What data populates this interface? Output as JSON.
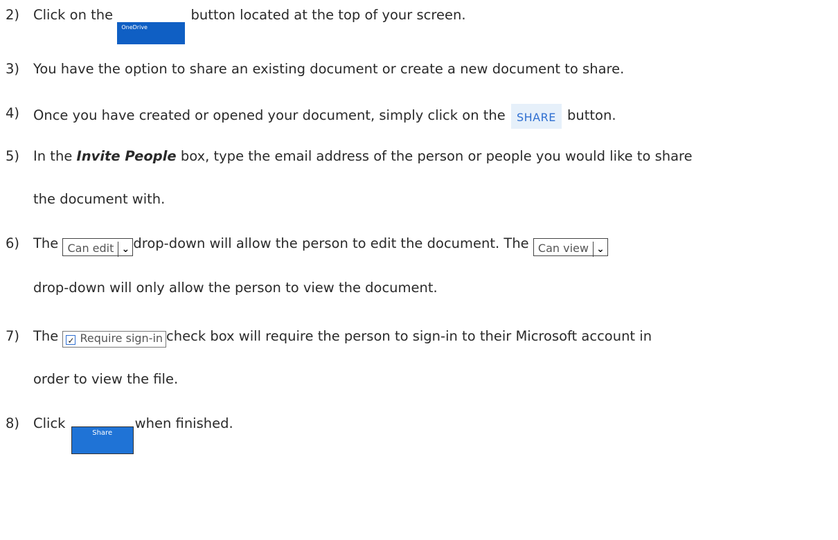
{
  "steps": [
    {
      "num": "2)",
      "pre": "Click on the ",
      "post": " button located at the top of your screen."
    },
    {
      "num": "3)",
      "text": "You have the option to share an existing document or create a new document to share."
    },
    {
      "num": "4)",
      "pre": "Once you have created or opened your document, simply click on the ",
      "post": " button."
    },
    {
      "num": "5)",
      "pre": "In the ",
      "emph": "Invite People",
      "post": " box, type the email address of the person or people you would like to share",
      "cont": "the document with."
    },
    {
      "num": "6)",
      "pre": "The ",
      "mid": "drop-down will allow the person to edit the document. The ",
      "cont": "drop-down will only allow the person to view the document."
    },
    {
      "num": "7)",
      "pre": "The ",
      "post": "check box will require the person to sign-in to their Microsoft account in",
      "cont": "order to view the file."
    },
    {
      "num": "8)",
      "pre": "Click ",
      "post": "when finished."
    }
  ],
  "widgets": {
    "onedrive_label": "OneDrive",
    "share_link_label": "SHARE",
    "can_edit_label": "Can edit",
    "can_view_label": "Can view",
    "dropdown_arrow": "✓",
    "require_signin_label": "Require sign-in",
    "checkbox_mark": "✓",
    "share_button_label": "Share"
  }
}
